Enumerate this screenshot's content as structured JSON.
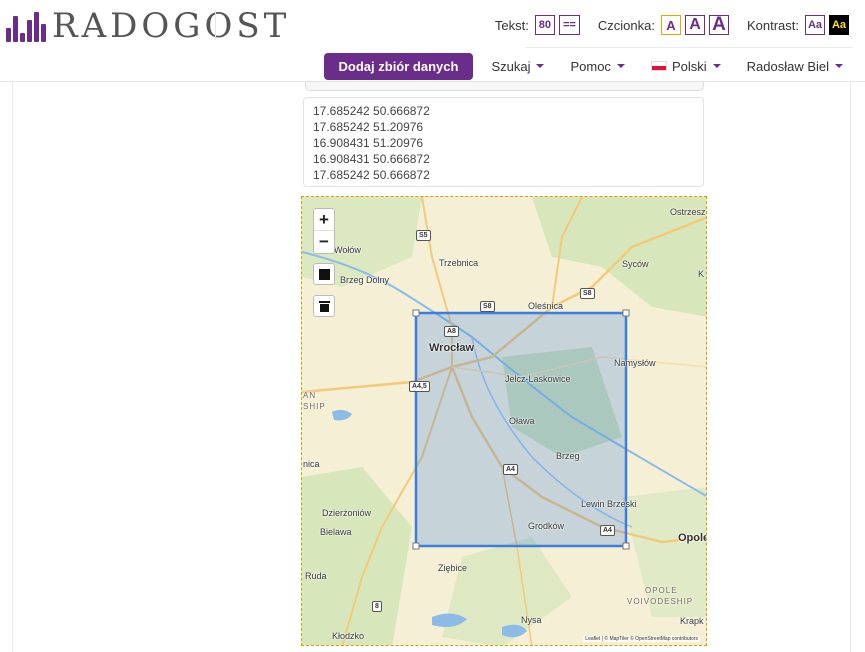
{
  "header": {
    "brand": "RADOGOST",
    "accessibility": {
      "text_label": "Tekst:",
      "text_size_value": "80",
      "text_spacing_label": "==",
      "font_label": "Czcionka:",
      "font_small": "A",
      "font_medium": "A",
      "font_large": "A",
      "contrast_label": "Kontrast:",
      "contrast_normal": "Aa",
      "contrast_high": "Aa"
    },
    "nav": {
      "add_dataset": "Dodaj zbiór danych",
      "search": "Szukaj",
      "help": "Pomoc",
      "language": "Polski",
      "user": "Radosław Biel"
    }
  },
  "coordinates": [
    "17.685242 50.666872",
    "17.685242 51.20976",
    "16.908431 51.20976",
    "16.908431 50.666872",
    "17.685242 50.666872"
  ],
  "map": {
    "controls": {
      "zoom_in": "+",
      "zoom_out": "−"
    },
    "labels": {
      "wolow": "Wołów",
      "brzeg_dolny": "Brzeg Dolny",
      "trzebnica": "Trzebnica",
      "sycow": "Syców",
      "olesnica": "Oleśnica",
      "wroclaw": "Wrocław",
      "namyslow": "Namysłów",
      "jelcz": "Jelcz-Laskowice",
      "olawa": "Oława",
      "brzeg": "Brzeg",
      "lewin": "Lewin Brzeski",
      "dzierzoniow": "Dzierżoniów",
      "bielawa": "Bielawa",
      "grodkow": "Grodków",
      "opole": "Opole",
      "ziebice": "Ziębice",
      "ruda": "Ruda",
      "nysa": "Nysa",
      "klodzko": "Kłodzko",
      "ostrzesz": "Ostrzesz",
      "krapk": "Krapk",
      "nica": "nica",
      "k": "K",
      "an_ship_1": "AN",
      "an_ship_2": "SHIP",
      "opole_region_1": "OPOLE",
      "opole_region_2": "VOIVODESHIP"
    },
    "roads": {
      "s5": "S5",
      "s8a": "S8",
      "s8b": "S8",
      "a8": "A8",
      "a45": "A4,5",
      "a4a": "A4",
      "a4b": "A4",
      "r8": "8"
    },
    "attribution": "Leaflet | © MapTiler © OpenStreetMap contributors",
    "selection_color": "#3a7ee0"
  },
  "colors": {
    "brand": "#6b2d8a"
  }
}
